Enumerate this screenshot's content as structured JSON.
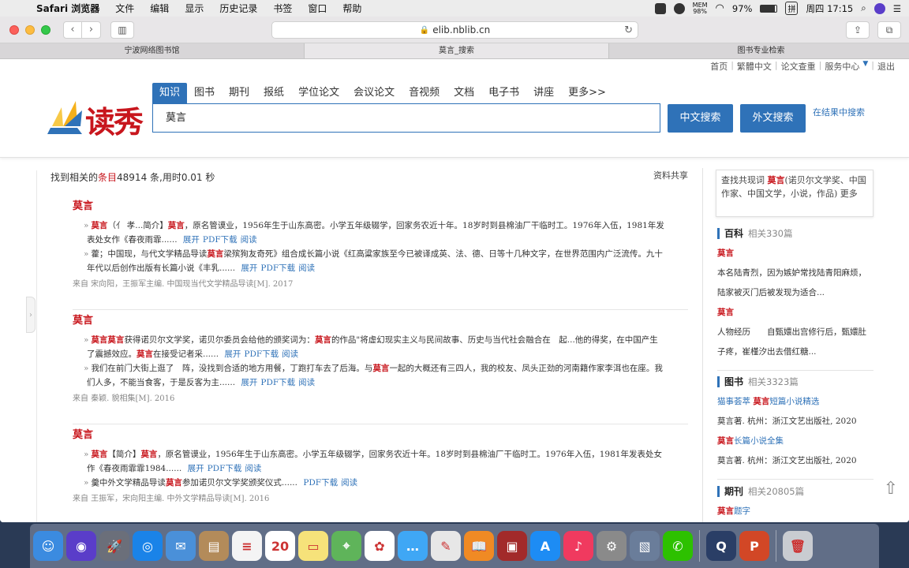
{
  "menubar": {
    "apple": "",
    "items": [
      "Safari 浏览器",
      "文件",
      "编辑",
      "显示",
      "历史记录",
      "书签",
      "窗口",
      "帮助"
    ],
    "mem_label": "MEM",
    "mem_value": "98%",
    "battery": "97%",
    "input_method": "拼",
    "clock": "周四 17:15"
  },
  "browser": {
    "url": "elib.nblib.cn",
    "tabs": [
      "宁波网络图书馆",
      "莫言_搜索",
      "图书专业检索"
    ],
    "back_glyph": "‹",
    "forward_glyph": "›",
    "reload_glyph": "↻",
    "lock_glyph": "🔒"
  },
  "header": {
    "toplinks": [
      "首页",
      "繁體中文",
      "论文查重",
      "服务中心",
      "退出"
    ],
    "logo_text": "读秀",
    "categories": [
      "知识",
      "图书",
      "期刊",
      "报纸",
      "学位论文",
      "会议论文",
      "音视频",
      "文档",
      "电子书",
      "讲座",
      "更多>>"
    ],
    "search_value": "莫言",
    "btn_cn": "中文搜索",
    "btn_en": "外文搜索",
    "in_results": "在结果中搜索"
  },
  "results": {
    "summary_prefix": "找到相关的",
    "summary_red": "条目",
    "summary_suffix": "48914 条,用时0.01 秒",
    "share": "资料共享",
    "expand": "展开",
    "pdf": "PDF下载",
    "read": "阅读",
    "items": [
      {
        "title": "莫言",
        "s1_a": "莫言",
        "s1_b": "（亻 孝...简介】",
        "s1_c": "莫言",
        "s1_d": "，原名管谟业，1956年生于山东高密。小学五年级辍学，回家务农近十年。18岁时到县棉油厂干临时工。1976年入伍，1981年发表处女作《春夜雨霏......",
        "s2_a": "藿；中国现，与代文学精品导读",
        "s2_b": "莫言",
        "s2_c": "梁殡狗友奇死》组合成长篇小说《红高粱家族至今已被译成英、法、德、日等十几种文字，在世界范围内广泛流传。九十年代以后创作出版有长篇小说《丰乳......",
        "source": "来自 宋向阳，王振军主编. 中国现当代文学精品导读[M]. 2017"
      },
      {
        "title": "莫言",
        "s1_a": "莫言莫言",
        "s1_b": "获得诺贝尔文学奖，诺贝尔委员会给他的颁奖词为：",
        "s1_c": "莫言",
        "s1_d": "的作品\"将虚幻现实主义与民间故事、历史与当代社会融合在　起...他的得奖，在中国产生了震撼效应。",
        "s1_e": "莫言",
        "s1_f": "在接受记者采......",
        "s2_a": "我们在前门大街上逛了　阵，没找到合适的地方用餐，丁跑打车去了后海。与",
        "s2_b": "莫言",
        "s2_c": "一起的大概还有三四人，我的校友、凤头正劲的河南籍作家李洱也在座。我们人多，不能当食客，于是反客为主......",
        "source": "来自 秦颖. 貌相集[M]. 2016"
      },
      {
        "title": "莫言",
        "s1_a": "莫言",
        "s1_b": "【简介】",
        "s1_c": "莫言",
        "s1_d": "，原名管谟业，1956年生于山东高密。小学五年级辍学，回家务农近十年。18岁时到县棉油厂干临时工。1976年入伍，1981年发表处女作《春夜雨霏霏1984......",
        "s2_a": "羹中外文学精品导读",
        "s2_b": "莫言",
        "s2_c": "参加诺贝尔文学奖颁奖仪式......",
        "source": "来自 王振军，宋向阳主编. 中外文学精品导读[M]. 2016"
      }
    ]
  },
  "sidebar": {
    "topic_prefix": "查找共现词",
    "topic_hl": "莫言",
    "topic_rest": "(诺贝尔文学奖、中国作家、中国文学，小说，作品) 更多",
    "baike_head": "百科",
    "baike_count": "相关330篇",
    "baike_rows": [
      {
        "text": "莫言",
        "style": "red"
      },
      {
        "text": "本名陆青烈，因为嫉妒常找陆青阳麻烦，",
        "style": "plain"
      },
      {
        "text": "陆家被灭门后被发现为适合...",
        "style": "plain"
      },
      {
        "text": "莫言",
        "style": "red"
      },
      {
        "text": "人物经历　　自甄嬛出宫修行后，甄嬛肚",
        "style": "plain"
      },
      {
        "text": "子疼，崔槿汐出去借红糖...",
        "style": "plain"
      }
    ],
    "books_head": "图书",
    "books_count": "相关3323篇",
    "book1_a": "猫事荟萃 ",
    "book1_b": "莫言",
    "book1_c": "短篇小说精选",
    "book1_src": "莫言著. 杭州：浙江文艺出版社, 2020",
    "book2_a": "莫言",
    "book2_b": "长篇小说全集",
    "book2_src": "莫言著. 杭州：浙江文艺出版社, 2020",
    "journal_head": "期刊",
    "journal_count": "相关20805篇",
    "journal1_a": "莫言",
    "journal1_b": "题字"
  },
  "dock": {
    "icons": [
      {
        "name": "finder",
        "color": "#3b8be0",
        "glyph": "☺"
      },
      {
        "name": "siri",
        "color": "#5a3dc9",
        "glyph": "◉"
      },
      {
        "name": "launchpad",
        "color": "#6b6f7a",
        "glyph": "🚀"
      },
      {
        "name": "safari",
        "color": "#1a83e8",
        "glyph": "◎"
      },
      {
        "name": "mail",
        "color": "#4a90d9",
        "glyph": "✉"
      },
      {
        "name": "contacts",
        "color": "#b38b5a",
        "glyph": "▤"
      },
      {
        "name": "reminders",
        "color": "#f4f4f4",
        "glyph": "≡"
      },
      {
        "name": "calendar",
        "color": "#ffffff",
        "glyph": "20"
      },
      {
        "name": "notes",
        "color": "#f6e27a",
        "glyph": "▭"
      },
      {
        "name": "maps",
        "color": "#5fb45a",
        "glyph": "⌖"
      },
      {
        "name": "photos",
        "color": "#ffffff",
        "glyph": "✿"
      },
      {
        "name": "messages",
        "color": "#3fa7f5",
        "glyph": "…"
      },
      {
        "name": "preview",
        "color": "#e7e7e7",
        "glyph": "✎"
      },
      {
        "name": "books",
        "color": "#f08a24",
        "glyph": "📖"
      },
      {
        "name": "photo-booth",
        "color": "#a22a2a",
        "glyph": "▣"
      },
      {
        "name": "app-store",
        "color": "#1d8cf4",
        "glyph": "A"
      },
      {
        "name": "music",
        "color": "#f03a5f",
        "glyph": "♪"
      },
      {
        "name": "system-preferences",
        "color": "#8a8a8a",
        "glyph": "⚙"
      },
      {
        "name": "image-capture",
        "color": "#6a7d9a",
        "glyph": "▧"
      },
      {
        "name": "wechat",
        "color": "#2dc100",
        "glyph": "✆"
      },
      {
        "name": "quicktime",
        "color": "#2a3e66",
        "glyph": "Q"
      },
      {
        "name": "powerpoint",
        "color": "#d24726",
        "glyph": "P"
      },
      {
        "name": "trash",
        "color": "#c9ccd1",
        "glyph": "🗑"
      }
    ]
  },
  "colors": {
    "accent_blue": "#2f72b8",
    "brand_red": "#c8161d"
  }
}
